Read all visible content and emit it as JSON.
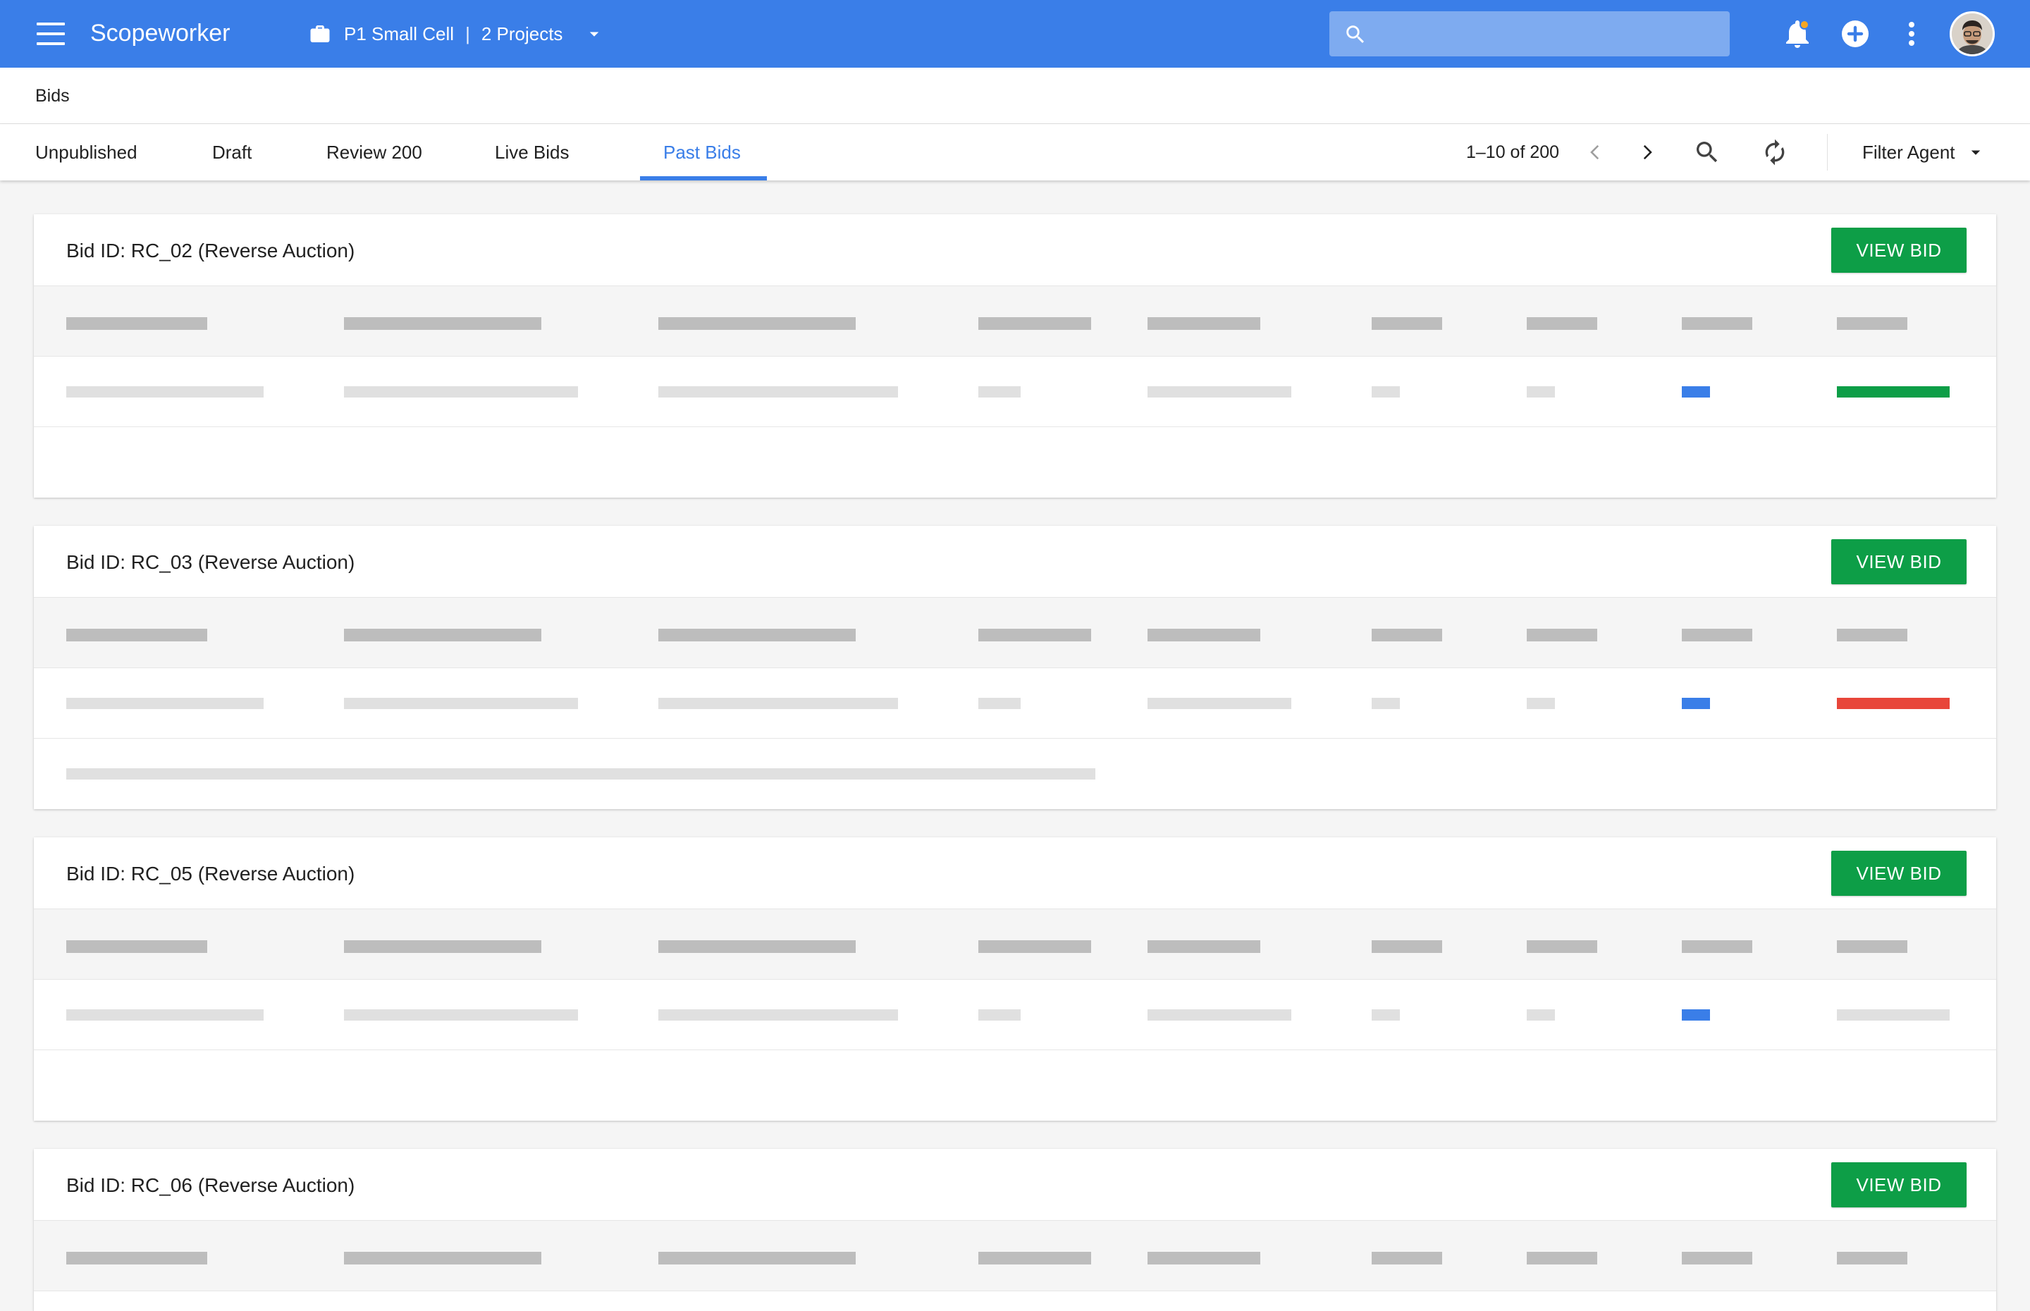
{
  "app": {
    "title": "Scopeworker",
    "project_name": "P1 Small Cell",
    "project_separator": "|",
    "project_count": "2 Projects",
    "search_placeholder": ""
  },
  "breadcrumb": "Bids",
  "tabs": [
    {
      "label": "Unpublished"
    },
    {
      "label": "Draft"
    },
    {
      "label": "Review 200"
    },
    {
      "label": "Live Bids"
    },
    {
      "label": "Past Bids",
      "active": true
    }
  ],
  "pager": {
    "range": "1–10 of 200"
  },
  "filter": {
    "label": "Filter Agent"
  },
  "colors": {
    "appbar": "#3a7ee8",
    "accent": "#3a7ee8",
    "button": "#0d9e47",
    "status_blue": "#3a7ee8",
    "status_green": "#0d9e47",
    "status_red": "#e8463a",
    "placeholder_header": "#bdbdbd",
    "placeholder_body": "#e0e0e0"
  },
  "bids": [
    {
      "title": "Bid ID: RC_02 (Reverse Auction)",
      "button": "VIEW BID",
      "status_type": "blue",
      "result": "green",
      "has_note": false
    },
    {
      "title": "Bid ID: RC_03 (Reverse Auction)",
      "button": "VIEW BID",
      "status_type": "blue",
      "result": "red",
      "has_note": true
    },
    {
      "title": "Bid ID: RC_05 (Reverse Auction)",
      "button": "VIEW BID",
      "status_type": "blue",
      "result": "none",
      "has_note": false
    },
    {
      "title": "Bid ID: RC_06 (Reverse Auction)",
      "button": "VIEW BID",
      "status_type": "blue",
      "result": "none",
      "has_note": false
    }
  ],
  "icons": {
    "menu": "menu-icon",
    "project": "briefcase-icon",
    "search": "search-icon",
    "notifications": "bell-icon",
    "add": "add-circle-icon",
    "more": "more-vert-icon",
    "prev": "chevron-left-icon",
    "next": "chevron-right-icon",
    "refresh": "refresh-icon",
    "dropdown": "arrow-drop-down-icon"
  }
}
